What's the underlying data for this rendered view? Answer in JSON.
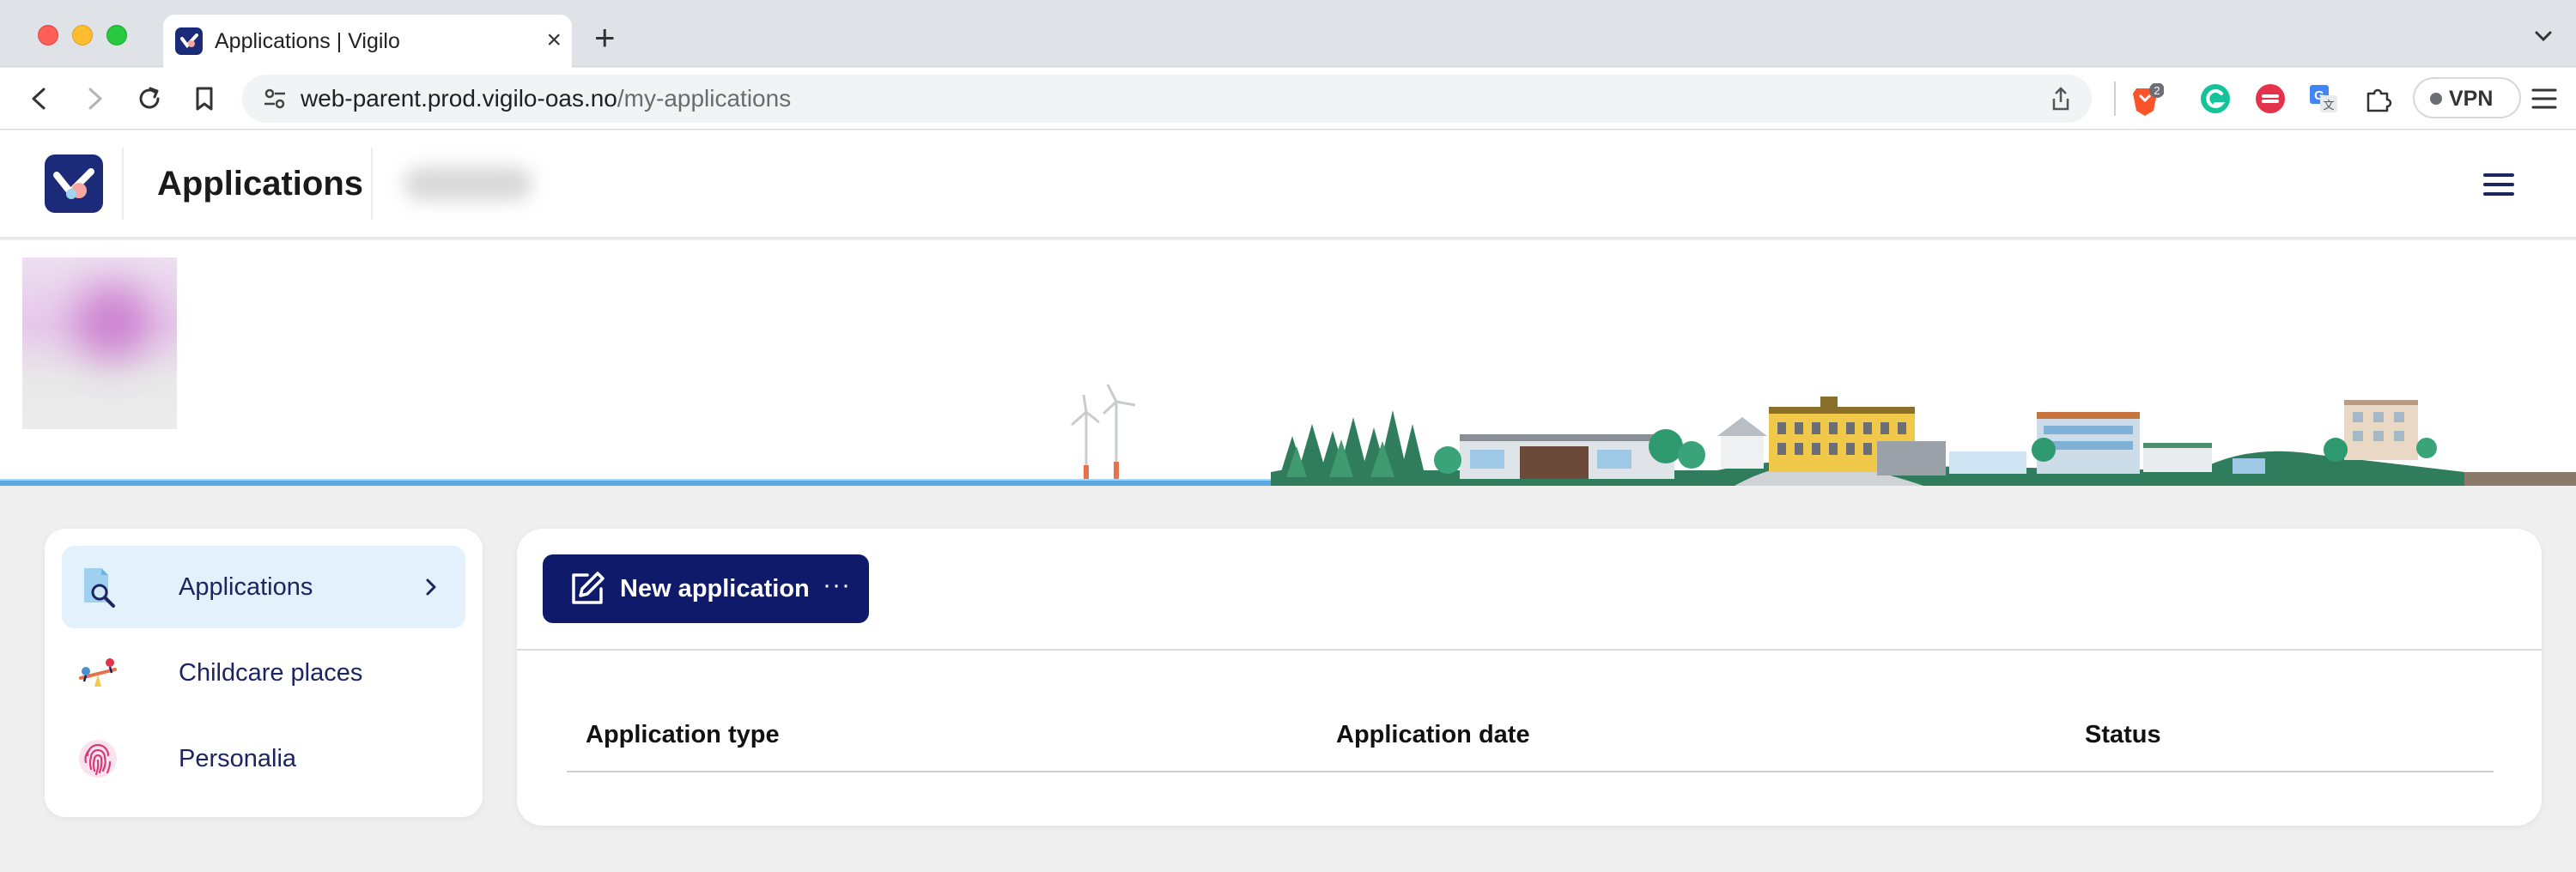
{
  "browser": {
    "tab_title": "Applications | Vigilo",
    "url_host": "web-parent.prod.vigilo-oas.no",
    "url_path": "/my-applications",
    "new_tab_label": "+",
    "close_label": "×",
    "brave_badge_count": "2",
    "vpn_label": "VPN"
  },
  "header": {
    "title": "Applications"
  },
  "sidebar": {
    "items": [
      {
        "label": "Applications",
        "icon": "document-search-icon",
        "active": true
      },
      {
        "label": "Childcare places",
        "icon": "playground-seesaw-icon",
        "active": false
      },
      {
        "label": "Personalia",
        "icon": "fingerprint-icon",
        "active": false
      }
    ]
  },
  "main": {
    "new_application_label": "New application",
    "more_label": "···",
    "table": {
      "headers": [
        "Application type",
        "Application date",
        "Status"
      ],
      "rows": []
    }
  },
  "colors": {
    "brand_navy": "#0f1a6b",
    "active_item_bg": "#e2f1fb",
    "sidebar_text": "#1c2560"
  }
}
